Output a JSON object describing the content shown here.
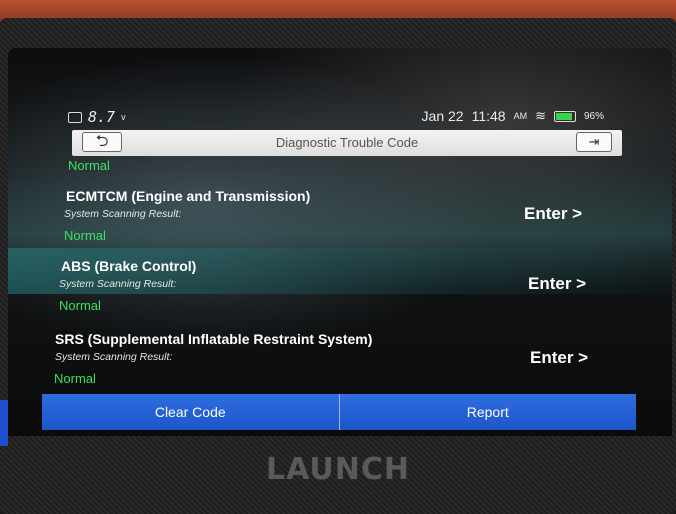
{
  "status_bar": {
    "voltage": "8.7",
    "voltage_unit": "v",
    "date": "Jan 22",
    "time": "11:48",
    "ampm": "AM",
    "battery": "96%"
  },
  "header": {
    "title": "Diagnostic Trouble Code"
  },
  "top_status": "Normal",
  "systems": [
    {
      "name": "ECMTCM (Engine and Transmission)",
      "label": "System Scanning Result:",
      "status": "Normal",
      "action": "Enter >"
    },
    {
      "name": "ABS (Brake Control)",
      "label": "System Scanning Result:",
      "status": "Normal",
      "action": "Enter >"
    },
    {
      "name": "SRS (Supplemental Inflatable Restraint System)",
      "label": "System Scanning Result:",
      "status": "Normal",
      "action": "Enter >"
    }
  ],
  "footer": {
    "clear_label": "Clear Code",
    "report_label": "Report"
  },
  "brand": "LAUNCH",
  "colors": {
    "accent_blue": "#2563d6",
    "status_green": "#3fe05b"
  },
  "icons": [
    "calendar-icon",
    "wifi-icon",
    "battery-icon",
    "back-arrow-icon",
    "exit-icon"
  ]
}
